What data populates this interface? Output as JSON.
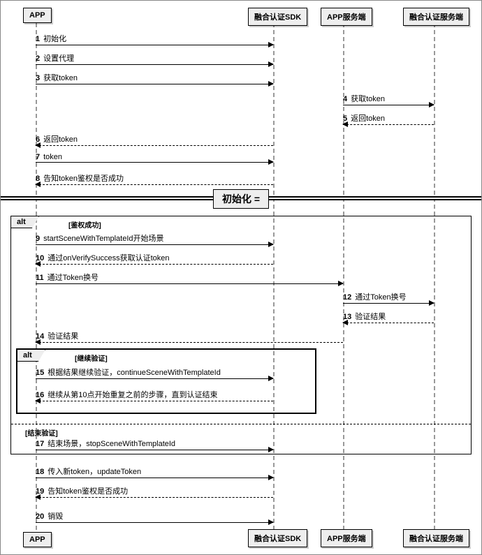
{
  "participants": {
    "app": "APP",
    "sdk": "融合认证SDK",
    "appServer": "APP服务端",
    "authServer": "融合认证服务端"
  },
  "divider": {
    "title": "初始化 ="
  },
  "altOuter": {
    "label": "alt",
    "cond1": "[鉴权成功]",
    "cond2": "[结束验证]"
  },
  "altInner": {
    "label": "alt",
    "cond": "[继续验证]"
  },
  "messages": {
    "m1": {
      "n": "1",
      "t": "初始化"
    },
    "m2": {
      "n": "2",
      "t": "设置代理"
    },
    "m3": {
      "n": "3",
      "t": "获取token"
    },
    "m4": {
      "n": "4",
      "t": "获取token"
    },
    "m5": {
      "n": "5",
      "t": "返回token"
    },
    "m6": {
      "n": "6",
      "t": "返回token"
    },
    "m7": {
      "n": "7",
      "t": "token"
    },
    "m8": {
      "n": "8",
      "t": "告知token鉴权是否成功"
    },
    "m9": {
      "n": "9",
      "t": "startSceneWithTemplateId开始场景"
    },
    "m10": {
      "n": "10",
      "t": "通过onVerifySuccess获取认证token"
    },
    "m11": {
      "n": "11",
      "t": "通过Token换号"
    },
    "m12": {
      "n": "12",
      "t": "通过Token换号"
    },
    "m13": {
      "n": "13",
      "t": "验证结果"
    },
    "m14": {
      "n": "14",
      "t": "验证结果"
    },
    "m15": {
      "n": "15",
      "t": "根据结果继续验证，continueSceneWithTemplateId"
    },
    "m16": {
      "n": "16",
      "t": "继续从第10点开始重复之前的步骤，直到认证结束"
    },
    "m17": {
      "n": "17",
      "t": "结束场景，stopSceneWithTemplateId"
    },
    "m18": {
      "n": "18",
      "t": "传入新token，updateToken"
    },
    "m19": {
      "n": "19",
      "t": "告知token鉴权是否成功"
    },
    "m20": {
      "n": "20",
      "t": "销毁"
    }
  }
}
